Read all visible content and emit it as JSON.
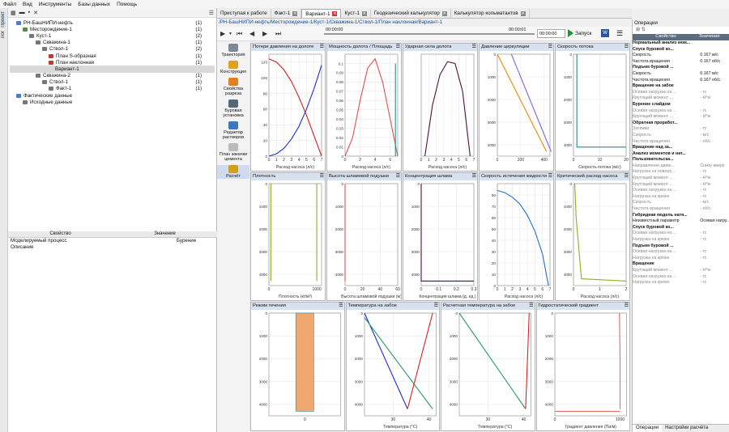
{
  "menu": [
    "Файл",
    "Вид",
    "Инструменты",
    "Базы данных",
    "Помощь"
  ],
  "left_strip": [
    "Проект",
    "Лог"
  ],
  "tree": [
    {
      "label": "РН-БашНИПИ-нефть",
      "count": "(1)",
      "indent": 1,
      "color": "#4a7bd0"
    },
    {
      "label": "Месторождение-1",
      "count": "(1)",
      "indent": 2,
      "color": "#5a8a3a"
    },
    {
      "label": "Куст-1",
      "count": "(2)",
      "indent": 3,
      "color": "#777777"
    },
    {
      "label": "Скважина-1",
      "count": "(1)",
      "indent": 4,
      "color": "#777777"
    },
    {
      "label": "Ствол-1",
      "count": "(2)",
      "indent": 5,
      "color": "#777777"
    },
    {
      "label": "План S-образная",
      "count": "(1)",
      "indent": 6,
      "color": "#cc3333"
    },
    {
      "label": "План наклонная",
      "count": "(1)",
      "indent": 6,
      "color": "#cc3333"
    },
    {
      "label": "Вариант-1",
      "count": "",
      "indent": 7,
      "color": "",
      "selected": true
    },
    {
      "label": "Скважина-2",
      "count": "(1)",
      "indent": 4,
      "color": "#777777"
    },
    {
      "label": "Ствол-1",
      "count": "(1)",
      "indent": 5,
      "color": "#777777"
    },
    {
      "label": "Факт-1",
      "count": "(1)",
      "indent": 6,
      "color": "#777777"
    },
    {
      "label": "Фактические данные",
      "count": "",
      "indent": 1,
      "color": "#4a7bd0"
    },
    {
      "label": "Исходные данные",
      "count": "",
      "indent": 2,
      "color": "#777777"
    }
  ],
  "props": {
    "header_name": "Свойство",
    "header_value": "Значение",
    "rows": [
      {
        "name": "Моделируемый процесс",
        "value": "Бурение"
      },
      {
        "name": "Описание",
        "value": ""
      }
    ]
  },
  "tabs": [
    {
      "label": "Приступая к работе",
      "closable": false
    },
    {
      "label": "Факт-1",
      "closable": true
    },
    {
      "label": "Вариант-1",
      "closable": true,
      "active": true
    },
    {
      "label": "Куст-1",
      "closable": true
    },
    {
      "label": "Геодезический калькулятор",
      "closable": true
    },
    {
      "label": "Калькулятор кольматантов",
      "closable": true
    }
  ],
  "breadcrumb": "/РН-БашНИПИ-нефть/Месторождение-1/Куст-1/Скважина-1/Ствол-1/План наклонная/Вариант-1",
  "playbar": {
    "time_start": "00:00:00",
    "time_end": "00:00:01",
    "time_select": "00:00:00",
    "launch": "Запуск"
  },
  "side_tools": [
    {
      "label": "Траектория",
      "color": "#7a8a9a"
    },
    {
      "label": "Конструкция",
      "color": "#e0a020"
    },
    {
      "label": "Свойства разреза",
      "color": "#e08020"
    },
    {
      "label": "Буровая установка",
      "color": "#556677"
    },
    {
      "label": "Редактор растворов",
      "color": "#3a7ac0"
    },
    {
      "label": "План закачки цемента",
      "color": "#bbbbbb"
    },
    {
      "label": "Расчёт",
      "color": "#d0a020",
      "selected": true
    }
  ],
  "chart_data": [
    {
      "title": "Потери давления на долоте",
      "type": "line",
      "xlabel": "Расход насоса (л/с)",
      "xlim": [
        0,
        7
      ],
      "ylim": [
        0,
        130
      ],
      "xticks": [
        0,
        1,
        2,
        3,
        4,
        5,
        6,
        7
      ],
      "yticks": [
        0,
        20,
        40,
        60,
        80,
        100,
        120
      ],
      "yinvert": false,
      "series": [
        {
          "color": "#d02020",
          "x": [
            0,
            1,
            2,
            3,
            4,
            5,
            6,
            7
          ],
          "y": [
            124,
            120,
            110,
            95,
            75,
            52,
            26,
            0
          ]
        },
        {
          "color": "#2030d0",
          "x": [
            0,
            1,
            2,
            3,
            4,
            5,
            6,
            7
          ],
          "y": [
            0,
            3,
            10,
            22,
            38,
            60,
            86,
            116
          ]
        }
      ]
    },
    {
      "title": "Мощность долота / Площадь",
      "type": "line",
      "xlabel": "Расход насоса (л/с)",
      "xlim": [
        0,
        7
      ],
      "ylim": [
        0,
        0.11
      ],
      "xticks": [
        0,
        2,
        4,
        6
      ],
      "yticks": [
        0,
        0.01,
        0.02,
        0.03,
        0.04,
        0.05,
        0.06,
        0.07,
        0.08,
        0.09,
        0.1
      ],
      "yinvert": false,
      "series": [
        {
          "color": "#e05050",
          "x": [
            0,
            1,
            2,
            3,
            4,
            5,
            6,
            7
          ],
          "y": [
            0,
            0.02,
            0.06,
            0.095,
            0.105,
            0.08,
            0.04,
            0
          ]
        },
        {
          "color": "#2a8a8a",
          "x": [
            6.7,
            6.7
          ],
          "y": [
            0,
            0.1
          ]
        }
      ]
    },
    {
      "title": "Ударная сила долота",
      "type": "line",
      "xlabel": "Расход насоса (л/с)",
      "xlim": [
        0,
        7
      ],
      "ylim": [
        0,
        110
      ],
      "xticks": [
        0,
        1,
        2,
        3,
        4,
        5,
        6,
        7
      ],
      "yticks": [],
      "yinvert": false,
      "series": [
        {
          "color": "#501040",
          "x": [
            0.5,
            1.5,
            2.5,
            3.5,
            4.5,
            5.5,
            6.5
          ],
          "y": [
            0,
            55,
            88,
            102,
            100,
            70,
            0
          ]
        }
      ]
    },
    {
      "title": "Давление циркуляции",
      "type": "line",
      "xlabel": "",
      "xlim": [
        0,
        450
      ],
      "ylim": [
        0,
        4500
      ],
      "xticks": [
        0,
        200,
        400
      ],
      "yticks": [
        0,
        1000,
        2000,
        3000,
        4000
      ],
      "yinvert": true,
      "series": [
        {
          "color": "#ee8800",
          "x": [
            0,
            420
          ],
          "y": [
            0,
            4300
          ]
        },
        {
          "color": "#8060e0",
          "x": [
            120,
            460
          ],
          "y": [
            0,
            4300
          ]
        }
      ]
    },
    {
      "title": "Скорость потока",
      "type": "line",
      "xlabel": "Скорость потока (м/с)",
      "xlim": [
        0,
        20
      ],
      "ylim": [
        0,
        4500
      ],
      "xticks": [
        0,
        10,
        20
      ],
      "yticks": [
        0,
        1000,
        2000,
        3000,
        4000
      ],
      "yinvert": true,
      "series": [
        {
          "color": "#2a8a8a",
          "x": [
            1.3,
            1.3,
            20
          ],
          "y": [
            0,
            4100,
            4100
          ]
        }
      ]
    },
    {
      "title": "Плотность",
      "type": "line",
      "xlabel": "Плотность (кг/м³)",
      "xlim": [
        0,
        1100
      ],
      "ylim": [
        0,
        4500
      ],
      "xticks": [
        0,
        1000
      ],
      "yticks": [
        0,
        1000,
        2000,
        3000,
        4000
      ],
      "yinvert": true,
      "series": [
        {
          "color": "#90b020",
          "x": [
            40,
            40
          ],
          "y": [
            0,
            4300
          ]
        },
        {
          "color": "#90b020",
          "x": [
            1000,
            1000
          ],
          "y": [
            0,
            4300
          ]
        }
      ]
    },
    {
      "title": "Высота шламовой подушки",
      "type": "line",
      "xlabel": "Высота шламовой подушки (м)",
      "xlim": [
        0,
        60
      ],
      "ylim": [
        0,
        4500
      ],
      "xticks": [
        0,
        20,
        40,
        60
      ],
      "yticks": [
        0,
        1000,
        2000,
        3000,
        4000
      ],
      "yinvert": true,
      "series": [
        {
          "color": "#e05050",
          "x": [
            0,
            0
          ],
          "y": [
            0,
            4300
          ]
        }
      ]
    },
    {
      "title": "Концентрация шлама",
      "type": "line",
      "xlabel": "Концентрация шлама (д. ед.)",
      "xlim": [
        0,
        0.3
      ],
      "ylim": [
        0,
        4500
      ],
      "xticks": [
        0,
        0.1,
        0.2,
        0.3
      ],
      "yticks": [
        0,
        1000,
        2000,
        3000,
        4000
      ],
      "yinvert": true,
      "series": [
        {
          "color": "#501040",
          "x": [
            0,
            0,
            0.3
          ],
          "y": [
            0,
            4300,
            4300
          ]
        }
      ]
    },
    {
      "title": "Скорость истечения жидкости",
      "type": "line",
      "xlabel": "Расход насоса (л/с)",
      "xlim": [
        0,
        7
      ],
      "ylim": [
        0,
        90
      ],
      "xticks": [
        0,
        1,
        2,
        3,
        4,
        5,
        6,
        7
      ],
      "yticks": [
        0,
        10,
        20,
        30,
        40,
        50,
        60,
        70,
        80
      ],
      "yinvert": false,
      "series": [
        {
          "color": "#2070d0",
          "x": [
            0,
            1,
            2,
            3,
            4,
            5,
            6,
            6.8
          ],
          "y": [
            84,
            82,
            78,
            72,
            62,
            48,
            28,
            0
          ]
        }
      ]
    },
    {
      "title": "Критический расход насоса",
      "type": "line",
      "xlabel": "Расход насоса (л/с)",
      "xlim": [
        0,
        2
      ],
      "ylim": [
        0,
        4500
      ],
      "xticks": [
        0,
        1,
        2
      ],
      "yticks": [
        0,
        1000,
        2000,
        3000,
        4000
      ],
      "yinvert": true,
      "series": [
        {
          "color": "#90b020",
          "x": [
            0.05,
            0.1,
            0.3,
            2
          ],
          "y": [
            0,
            1500,
            4200,
            4300
          ]
        }
      ]
    },
    {
      "title": "Режим течения",
      "type": "area",
      "xlabel": "",
      "xlim": [
        -1,
        1
      ],
      "ylim": [
        0,
        4500
      ],
      "xticks": [
        0
      ],
      "yticks": [
        0,
        1000,
        2000,
        3000,
        4000
      ],
      "yinvert": true,
      "series": [
        {
          "color": "#f0a870",
          "x": [
            -0.25,
            0.25
          ],
          "y": [
            0,
            4300
          ]
        }
      ]
    },
    {
      "title": "Температура на забое",
      "type": "line",
      "xlabel": "Температура (°C)",
      "xlim": [
        22,
        42
      ],
      "ylim": [
        0,
        4500
      ],
      "xticks": [
        30,
        40
      ],
      "yticks": [
        0,
        1000,
        2000,
        3000,
        4000
      ],
      "yinvert": true,
      "series": [
        {
          "color": "#2030d0",
          "x": [
            22,
            34
          ],
          "y": [
            0,
            4200
          ]
        },
        {
          "color": "#2a9a6a",
          "x": [
            22,
            41
          ],
          "y": [
            200,
            4200
          ]
        },
        {
          "color": "#e02020",
          "x": [
            34,
            41
          ],
          "y": [
            4200,
            0
          ]
        }
      ]
    },
    {
      "title": "Расчетная температура на забое",
      "type": "line",
      "xlabel": "Температура (°C)",
      "xlim": [
        22,
        42
      ],
      "ylim": [
        0,
        4500
      ],
      "xticks": [
        30,
        40
      ],
      "yticks": [
        0,
        1000,
        2000,
        3000,
        4000
      ],
      "yinvert": true,
      "series": [
        {
          "color": "#2a9a6a",
          "x": [
            22,
            40.5
          ],
          "y": [
            0,
            4200
          ]
        },
        {
          "color": "#e02020",
          "x": [
            40.5,
            41.5
          ],
          "y": [
            4200,
            0
          ]
        }
      ]
    },
    {
      "title": "Гидростатический градиент",
      "type": "line",
      "xlabel": "Градиент давления (Па/м)",
      "xlim": [
        0,
        1100
      ],
      "ylim": [
        0,
        4500
      ],
      "xticks": [
        0,
        1000
      ],
      "yticks": [
        0,
        1000,
        2000,
        3000,
        4000
      ],
      "yinvert": true,
      "series": [
        {
          "color": "#e07070",
          "x": [
            990,
            995,
            1000,
            1000,
            1000
          ],
          "y": [
            0,
            1000,
            2000,
            3000,
            4200
          ]
        },
        {
          "color": "#e07070",
          "x": [
            0,
            1000
          ],
          "y": [
            4300,
            4300
          ]
        }
      ]
    }
  ],
  "right": {
    "title": "Операции",
    "header_name": "Свойство",
    "header_value": "Значение",
    "rows": [
      {
        "n": "Нормальный анализ мом...",
        "v": "",
        "c": "grp"
      },
      {
        "n": "  Спуск буровой ко...",
        "v": "",
        "c": "grp"
      },
      {
        "n": "   Скорость",
        "v": "0.167 м/с",
        "c": ""
      },
      {
        "n": "   Частота вращения",
        "v": "0.167 об/с",
        "c": ""
      },
      {
        "n": "  Подъем буровой ...",
        "v": "",
        "c": "grp"
      },
      {
        "n": "   Скорость",
        "v": "0.167 м/с",
        "c": ""
      },
      {
        "n": "   Частота вращения",
        "v": "0.167 об/с",
        "c": ""
      },
      {
        "n": "  Вращение на забое",
        "v": "",
        "c": "grp"
      },
      {
        "n": "   Осевая нагрузка на ...",
        "v": "- тс",
        "c": "dim"
      },
      {
        "n": "   Крутящий момент ...",
        "v": "- Н*м",
        "c": "dim"
      },
      {
        "n": "  Бурение слайдом",
        "v": "",
        "c": "grp"
      },
      {
        "n": "   Осевая нагрузка на ...",
        "v": "- тс",
        "c": "dim"
      },
      {
        "n": "   Крутящий момент ...",
        "v": "- Н*м",
        "c": "dim"
      },
      {
        "n": "  Обратная проработ...",
        "v": "",
        "c": "grp"
      },
      {
        "n": "   Затяжки",
        "v": "- тс",
        "c": "dim"
      },
      {
        "n": "   Скорость",
        "v": "- м/с",
        "c": "dim"
      },
      {
        "n": "   Частота вращения",
        "v": "- об/с",
        "c": "dim"
      },
      {
        "n": "  Вращение над за...",
        "v": "",
        "c": "grp"
      },
      {
        "n": "Анализ моментов и нат...",
        "v": "",
        "c": "grp"
      },
      {
        "n": "  Пользовательска...",
        "v": "",
        "c": "grp"
      },
      {
        "n": "   Направление движ...",
        "v": "Снизу вверх",
        "c": "dim"
      },
      {
        "n": "   Нагрузка на поверх...",
        "v": "- тс",
        "c": "dim"
      },
      {
        "n": "   Крутящий момент ...",
        "v": "- Н*м",
        "c": "dim"
      },
      {
        "n": "   Крутящий момент ...",
        "v": "- Н*м",
        "c": "dim"
      },
      {
        "n": "   Осевая нагрузка на ...",
        "v": "- тс",
        "c": "dim"
      },
      {
        "n": "   Нагрузка на крюке",
        "v": "- тс",
        "c": "dim"
      },
      {
        "n": "   Скорость",
        "v": "- м/с",
        "c": "dim"
      },
      {
        "n": "   Частота вращения",
        "v": "- об/с",
        "c": "dim"
      },
      {
        "n": "Гибридная модель натя...",
        "v": "",
        "c": "grp"
      },
      {
        "n": "  Неизвестный параметр",
        "v": "Осевая нагру...",
        "c": ""
      },
      {
        "n": "  Спуск буровой ко...",
        "v": "",
        "c": "grp"
      },
      {
        "n": "   Осевая нагрузка на ...",
        "v": "- тс",
        "c": "dim"
      },
      {
        "n": "   Нагрузка на крюке",
        "v": "- тс",
        "c": "dim"
      },
      {
        "n": "  Подъем буровой ...",
        "v": "",
        "c": "grp"
      },
      {
        "n": "   Осевая нагрузка на ...",
        "v": "- тс",
        "c": "dim"
      },
      {
        "n": "   Нагрузка на крюке",
        "v": "- тс",
        "c": "dim"
      },
      {
        "n": "  Вращение",
        "v": "",
        "c": "grp"
      },
      {
        "n": "   Крутящий момент ...",
        "v": "- Н*м",
        "c": "dim"
      },
      {
        "n": "   Осевая нагрузка на ...",
        "v": "- тс",
        "c": "dim"
      },
      {
        "n": "   Нагрузка на крюке",
        "v": "- тс",
        "c": "dim"
      }
    ],
    "bottom_tabs": [
      "Операции",
      "Настройки расчёта"
    ]
  }
}
